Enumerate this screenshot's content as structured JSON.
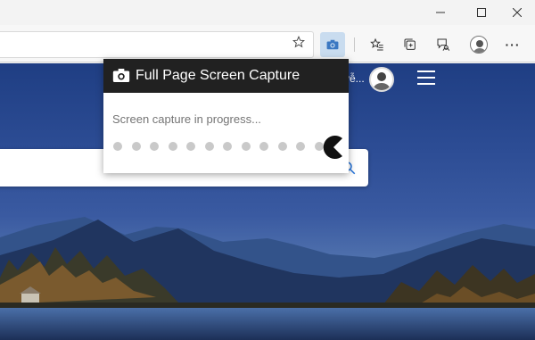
{
  "titlebar": {
    "controls": [
      {
        "name": "minimize-button",
        "icon": "minimize-icon"
      },
      {
        "name": "maximize-button",
        "icon": "maximize-icon"
      },
      {
        "name": "close-button",
        "icon": "close-icon"
      }
    ]
  },
  "toolbar": {
    "address_value": "",
    "favorite_icon": "star-outline-icon",
    "extension_icon": "camera-icon",
    "buttons": [
      {
        "name": "favorites-button",
        "icon": "favorites-icon"
      },
      {
        "name": "collections-button",
        "icon": "collections-icon"
      },
      {
        "name": "feedback-button",
        "icon": "feedback-icon"
      },
      {
        "name": "profile-button",
        "icon": "avatar"
      },
      {
        "name": "more-button",
        "icon": "ellipsis-icon",
        "label": "···"
      }
    ]
  },
  "page": {
    "user_name_partial": "yễ...",
    "menu_icon": "hamburger-menu-icon",
    "search_icon": "search-icon"
  },
  "popup": {
    "title": "Full Page Screen Capture",
    "status": "Screen capture in progress...",
    "progress_dots": 12,
    "header_color": "#212121"
  },
  "colors": {
    "accent": "#1e6fd9",
    "extension_highlight": "#c9dcef"
  }
}
